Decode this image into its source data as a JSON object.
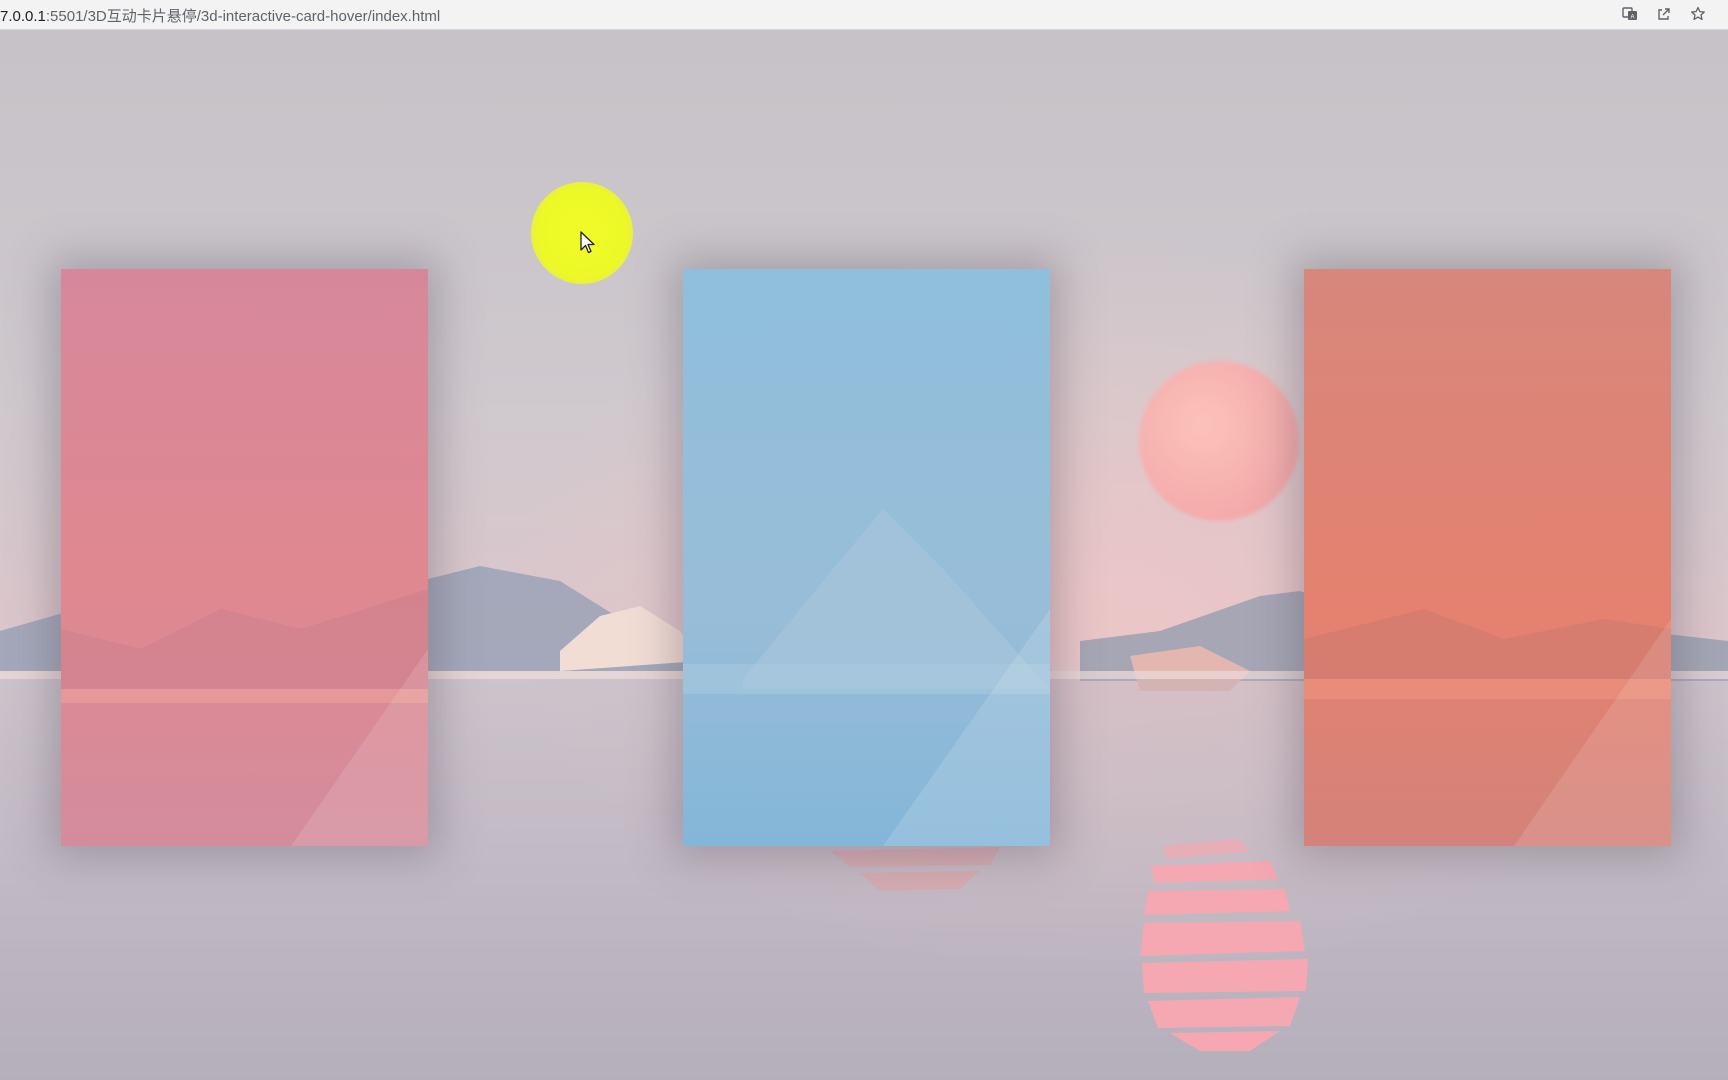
{
  "browser": {
    "url_host": "7.0.0.1",
    "url_rest": ":5501/3D互动卡片悬停/3d-interactive-card-hover/index.html",
    "icons": [
      "translate-icon",
      "share-icon",
      "bookmark-star-icon"
    ]
  },
  "colors": {
    "background": "#c9c4cc",
    "card_pink": "#d98a9a",
    "card_blue": "#8fbedc",
    "card_coral": "#de8477",
    "sun": "#f6b2ac",
    "cursor_highlight": "#eef826"
  },
  "cards": [
    {
      "name": "card-pink",
      "color": "#d98a9a"
    },
    {
      "name": "card-blue",
      "color": "#8fbedc"
    },
    {
      "name": "card-coral",
      "color": "#de8477"
    }
  ]
}
